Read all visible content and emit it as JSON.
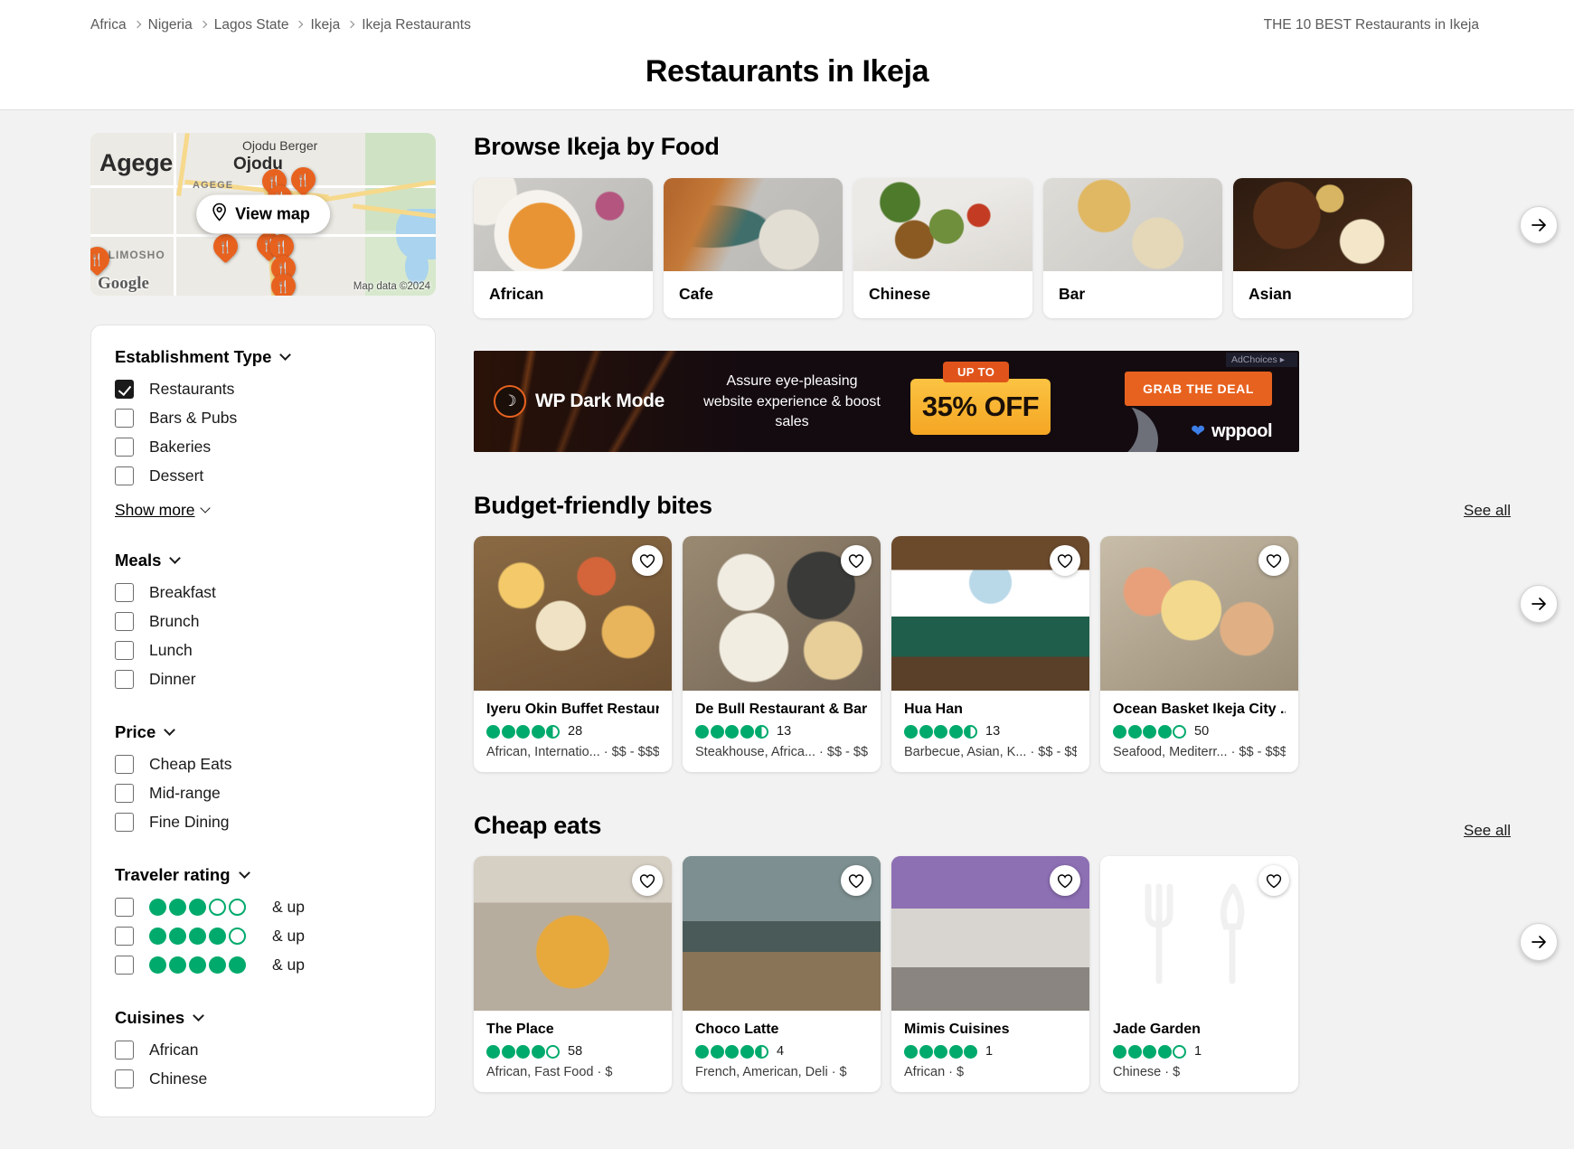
{
  "header": {
    "breadcrumb": [
      "Africa",
      "Nigeria",
      "Lagos State",
      "Ikeja",
      "Ikeja Restaurants"
    ],
    "top_right": "THE 10 BEST Restaurants in Ikeja",
    "title": "Restaurants in Ikeja"
  },
  "map": {
    "labels": {
      "agege_big": "Agege",
      "agege_small": "AGEGE",
      "ojodu_berger": "Ojodu Berger",
      "ojodu": "Ojodu",
      "alimosho": "ALIMOSHO"
    },
    "view_map_label": "View map",
    "google_logo": "Google",
    "attribution": "Map data ©2024"
  },
  "filters": [
    {
      "title": "Establishment Type",
      "options": [
        {
          "label": "Restaurants",
          "checked": true
        },
        {
          "label": "Bars & Pubs",
          "checked": false
        },
        {
          "label": "Bakeries",
          "checked": false
        },
        {
          "label": "Dessert",
          "checked": false
        }
      ],
      "show_more": "Show more"
    },
    {
      "title": "Meals",
      "options": [
        {
          "label": "Breakfast",
          "checked": false
        },
        {
          "label": "Brunch",
          "checked": false
        },
        {
          "label": "Lunch",
          "checked": false
        },
        {
          "label": "Dinner",
          "checked": false
        }
      ]
    },
    {
      "title": "Price",
      "options": [
        {
          "label": "Cheap Eats",
          "checked": false
        },
        {
          "label": "Mid-range",
          "checked": false
        },
        {
          "label": "Fine Dining",
          "checked": false
        }
      ]
    },
    {
      "title": "Traveler rating",
      "rating_options": [
        {
          "rating": 3,
          "suffix": "& up",
          "checked": false
        },
        {
          "rating": 4,
          "suffix": "& up",
          "checked": false
        },
        {
          "rating": 5,
          "suffix": "& up",
          "checked": false
        }
      ]
    },
    {
      "title": "Cuisines",
      "options": [
        {
          "label": "African",
          "checked": false
        },
        {
          "label": "Chinese",
          "checked": false
        }
      ]
    }
  ],
  "browse": {
    "title": "Browse Ikeja by Food",
    "categories": [
      {
        "label": "African",
        "image": "african-food-photo"
      },
      {
        "label": "Cafe",
        "image": "cafe-croissant-photo"
      },
      {
        "label": "Chinese",
        "image": "chinese-stirfry-photo"
      },
      {
        "label": "Bar",
        "image": "bar-beer-photo"
      },
      {
        "label": "Asian",
        "image": "asian-ramen-photo"
      }
    ]
  },
  "ad": {
    "brand": "WP Dark Mode",
    "copy": "Assure eye-pleasing website experience & boost sales",
    "badge": "UP TO",
    "discount": "35% OFF",
    "cta": "GRAB THE DEAL",
    "network": "wppool",
    "adchoices": "AdChoices"
  },
  "sections": [
    {
      "title": "Budget-friendly bites",
      "see_all": "See all",
      "cards": [
        {
          "name": "Iyeru Okin Buffet Restaur...",
          "rating": 4.5,
          "reviews": "28",
          "meta": "African, Internatio...  ·  $$ - $$$",
          "image": "buffet-spread-photo"
        },
        {
          "name": "De Bull Restaurant & Bar",
          "rating": 4.5,
          "reviews": "13",
          "meta": "Steakhouse, Africa...  ·  $$ - $$$",
          "image": "plated-dishes-photo"
        },
        {
          "name": "Hua Han",
          "rating": 4.5,
          "reviews": "13",
          "meta": "Barbecue, Asian, K...  ·  $$ - $$$",
          "image": "restaurant-interior-photo"
        },
        {
          "name": "Ocean Basket Ikeja City ...",
          "rating": 4.0,
          "reviews": "50",
          "meta": "Seafood, Mediterr...  ·  $$ - $$$",
          "image": "seafood-platter-photo"
        }
      ]
    },
    {
      "title": "Cheap eats",
      "see_all": "See all",
      "cards": [
        {
          "name": "The Place",
          "rating": 4.0,
          "reviews": "58",
          "meta": "African, Fast Food · $",
          "image": "rice-plate-photo"
        },
        {
          "name": "Choco Latte",
          "rating": 4.5,
          "reviews": "4",
          "meta": "French, American, Deli · $",
          "image": "cafe-interior-photo"
        },
        {
          "name": "Mimis Cuisines",
          "rating": 5.0,
          "reviews": "1",
          "meta": "African · $",
          "image": "storefront-photo"
        },
        {
          "name": "Jade Garden",
          "rating": 4.0,
          "reviews": "1",
          "meta": "Chinese · $",
          "image": "no-photo-placeholder"
        }
      ]
    }
  ]
}
